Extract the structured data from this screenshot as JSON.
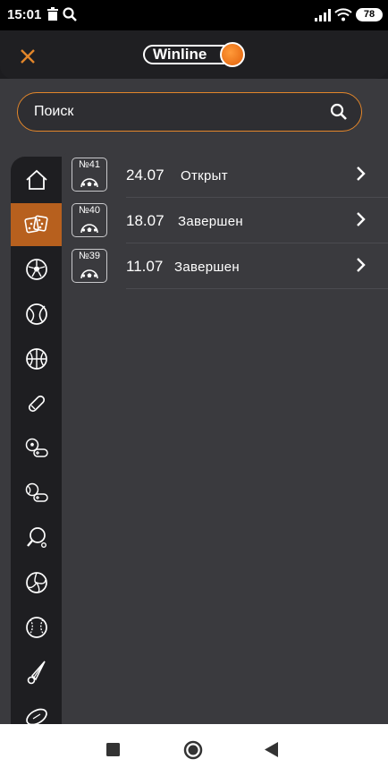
{
  "status_bar": {
    "time": "15:01",
    "battery": "78"
  },
  "header": {
    "logo_text": "Winline"
  },
  "search": {
    "placeholder": "Поиск"
  },
  "sidebar": {
    "items": [
      {
        "icon": "home-icon"
      },
      {
        "icon": "dice-icon",
        "active": true
      },
      {
        "icon": "soccer-ball-icon"
      },
      {
        "icon": "tennis-ball-icon"
      },
      {
        "icon": "basketball-icon"
      },
      {
        "icon": "hockey-puck-icon"
      },
      {
        "icon": "esports-soccer-icon"
      },
      {
        "icon": "esports-tennis-icon"
      },
      {
        "icon": "table-tennis-icon"
      },
      {
        "icon": "volleyball-icon"
      },
      {
        "icon": "baseball-icon"
      },
      {
        "icon": "badminton-icon"
      },
      {
        "icon": "rugby-ball-icon"
      }
    ]
  },
  "rounds": [
    {
      "number": "№41",
      "date": "24.07",
      "status": "Открыт"
    },
    {
      "number": "№40",
      "date": "18.07",
      "status": "Завершен"
    },
    {
      "number": "№39",
      "date": "11.07",
      "status": "Завершен"
    }
  ],
  "colors": {
    "accent": "#e3862a",
    "active_tab": "#b7601e",
    "panel": "#3a3a3e",
    "sidebar": "#1e1e21"
  }
}
